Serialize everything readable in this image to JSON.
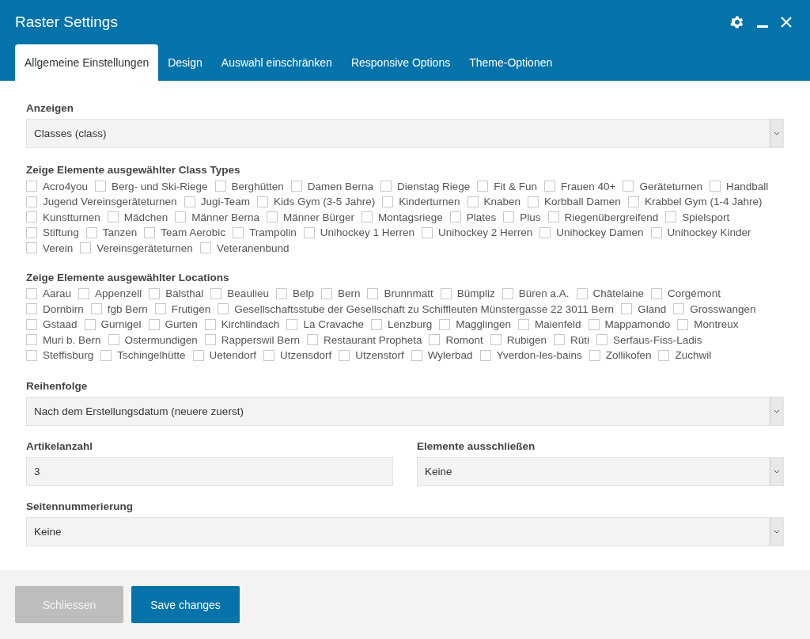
{
  "window": {
    "title": "Raster Settings"
  },
  "tabs": [
    {
      "label": "Allgemeine Einstellungen",
      "selected": true
    },
    {
      "label": "Design",
      "selected": false
    },
    {
      "label": "Auswahl einschränken",
      "selected": false
    },
    {
      "label": "Responsive Options",
      "selected": false
    },
    {
      "label": "Theme-Optionen",
      "selected": false
    }
  ],
  "display": {
    "label": "Anzeigen",
    "value": "Classes (class)"
  },
  "class_types": {
    "label": "Zeige Elemente ausgewählter Class Types",
    "options": [
      {
        "label": "Acro4you",
        "checked": false
      },
      {
        "label": "Berg- und Ski-Riege",
        "checked": false
      },
      {
        "label": "Berghütten",
        "checked": false
      },
      {
        "label": "Damen Berna",
        "checked": false
      },
      {
        "label": "Dienstag Riege",
        "checked": false
      },
      {
        "label": "Fit & Fun",
        "checked": false
      },
      {
        "label": "Frauen 40+",
        "checked": false
      },
      {
        "label": "Geräteturnen",
        "checked": false
      },
      {
        "label": "Handball",
        "checked": false
      },
      {
        "label": "Jugend Vereinsgeräteturnen",
        "checked": false
      },
      {
        "label": "Jugi-Team",
        "checked": false
      },
      {
        "label": "Kids Gym (3-5 Jahre)",
        "checked": false
      },
      {
        "label": "Kinderturnen",
        "checked": false
      },
      {
        "label": "Knaben",
        "checked": false
      },
      {
        "label": "Korbball Damen",
        "checked": false
      },
      {
        "label": "Krabbel Gym (1-4 Jahre)",
        "checked": false
      },
      {
        "label": "Kunstturnen",
        "checked": false
      },
      {
        "label": "Mädchen",
        "checked": false
      },
      {
        "label": "Männer Berna",
        "checked": false
      },
      {
        "label": "Männer Bürger",
        "checked": false
      },
      {
        "label": "Montagsriege",
        "checked": false
      },
      {
        "label": "Plates",
        "checked": false
      },
      {
        "label": "Plus",
        "checked": false
      },
      {
        "label": "Riegenübergreifend",
        "checked": false
      },
      {
        "label": "Spielsport",
        "checked": false
      },
      {
        "label": "Stiftung",
        "checked": false
      },
      {
        "label": "Tanzen",
        "checked": false
      },
      {
        "label": "Team Aerobic",
        "checked": false
      },
      {
        "label": "Trampolin",
        "checked": false
      },
      {
        "label": "Unihockey 1 Herren",
        "checked": false
      },
      {
        "label": "Unihockey 2 Herren",
        "checked": false
      },
      {
        "label": "Unihockey Damen",
        "checked": false
      },
      {
        "label": "Unihockey Kinder",
        "checked": false
      },
      {
        "label": "Verein",
        "checked": false
      },
      {
        "label": "Vereinsgeräteturnen",
        "checked": false
      },
      {
        "label": "Veteranenbund",
        "checked": false
      }
    ]
  },
  "locations": {
    "label": "Zeige Elemente ausgewählter Locations",
    "options": [
      {
        "label": "Aarau",
        "checked": false
      },
      {
        "label": "Appenzell",
        "checked": false
      },
      {
        "label": "Balsthal",
        "checked": false
      },
      {
        "label": "Beaulieu",
        "checked": false
      },
      {
        "label": "Belp",
        "checked": false
      },
      {
        "label": "Bern",
        "checked": false
      },
      {
        "label": "Brunnmatt",
        "checked": false
      },
      {
        "label": "Bümpliz",
        "checked": false
      },
      {
        "label": "Büren a.A.",
        "checked": false
      },
      {
        "label": "Châtelaine",
        "checked": false
      },
      {
        "label": "Corgémont",
        "checked": false
      },
      {
        "label": "Dornbirn",
        "checked": false
      },
      {
        "label": "fgb Bern",
        "checked": false
      },
      {
        "label": "Frutigen",
        "checked": false
      },
      {
        "label": "Gesellschaftsstube der Gesellschaft zu Schiffleuten Münstergasse 22 3011 Bern",
        "checked": false
      },
      {
        "label": "Gland",
        "checked": false
      },
      {
        "label": "Grosswangen",
        "checked": false
      },
      {
        "label": "Gstaad",
        "checked": false
      },
      {
        "label": "Gurnigel",
        "checked": false
      },
      {
        "label": "Gurten",
        "checked": false
      },
      {
        "label": "Kirchlindach",
        "checked": false
      },
      {
        "label": "La Cravache",
        "checked": false
      },
      {
        "label": "Lenzburg",
        "checked": false
      },
      {
        "label": "Magglingen",
        "checked": false
      },
      {
        "label": "Maienfeld",
        "checked": false
      },
      {
        "label": "Mappamondo",
        "checked": false
      },
      {
        "label": "Montreux",
        "checked": false
      },
      {
        "label": "Muri b. Bern",
        "checked": false
      },
      {
        "label": "Ostermundigen",
        "checked": false
      },
      {
        "label": "Rapperswil Bern",
        "checked": false
      },
      {
        "label": "Restaurant Propheta",
        "checked": false
      },
      {
        "label": "Romont",
        "checked": false
      },
      {
        "label": "Rubigen",
        "checked": false
      },
      {
        "label": "Rüti",
        "checked": false
      },
      {
        "label": "Serfaus-Fiss-Ladis",
        "checked": false
      },
      {
        "label": "Steffisburg",
        "checked": false
      },
      {
        "label": "Tschingelhütte",
        "checked": false
      },
      {
        "label": "Uetendorf",
        "checked": false
      },
      {
        "label": "Utzensdorf",
        "checked": false
      },
      {
        "label": "Utzenstorf",
        "checked": false
      },
      {
        "label": "Wylerbad",
        "checked": false
      },
      {
        "label": "Yverdon-les-bains",
        "checked": false
      },
      {
        "label": "Zollikofen",
        "checked": false
      },
      {
        "label": "Zuchwil",
        "checked": false
      }
    ]
  },
  "order": {
    "label": "Reihenfolge",
    "value": "Nach dem Erstellungsdatum (neuere zuerst)"
  },
  "article_count": {
    "label": "Artikelanzahl",
    "value": "3"
  },
  "exclude": {
    "label": "Elemente ausschließen",
    "value": "Keine"
  },
  "pagination": {
    "label": "Seitennummerierung",
    "value": "Keine"
  },
  "buttons": [
    {
      "label": "Schliessen",
      "kind": "secondary"
    },
    {
      "label": "Save changes",
      "kind": "primary"
    }
  ]
}
